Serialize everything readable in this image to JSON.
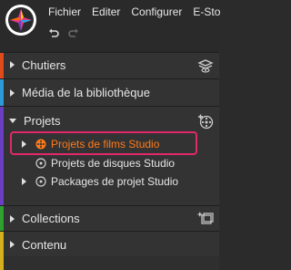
{
  "menu": {
    "items": [
      "Fichier",
      "Editer",
      "Configurer",
      "E-Sto"
    ]
  },
  "panels": {
    "chutiers": {
      "label": "Chutiers",
      "color": "#e04b1b"
    },
    "media": {
      "label": "Média de la bibliothèque",
      "color": "#2d9ad8"
    },
    "projets": {
      "label": "Projets",
      "color": "#6b3fc1"
    },
    "collections": {
      "label": "Collections",
      "color": "#2fa02f"
    },
    "contenu": {
      "label": "Contenu",
      "color": "#d4b01c"
    }
  },
  "projets_tree": {
    "items": [
      {
        "label": "Projets de films Studio",
        "highlighted": true,
        "icon": "film-reel-icon"
      },
      {
        "label": "Projets de disques Studio",
        "highlighted": false,
        "icon": "disc-icon"
      },
      {
        "label": "Packages de projet Studio",
        "highlighted": false,
        "icon": "disc-icon"
      }
    ]
  },
  "colors": {
    "highlight_text": "#ff7a1a",
    "highlight_border": "#e0286a"
  }
}
